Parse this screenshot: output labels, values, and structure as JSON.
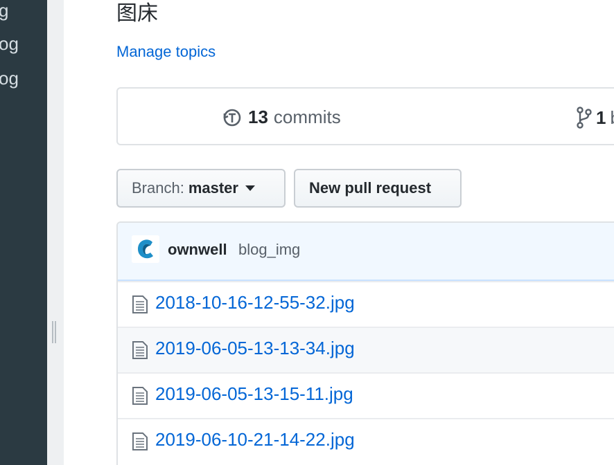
{
  "sidebar": {
    "items": [
      {
        "label": "g"
      },
      {
        "label": "og"
      },
      {
        "label": "og"
      }
    ]
  },
  "repo": {
    "description": "图床",
    "manage_topics": "Manage topics"
  },
  "summary": {
    "commits_count": "13",
    "commits_label": "commits",
    "branches_count": "1",
    "branches_label": "b"
  },
  "toolbar": {
    "branch_prefix": "Branch:",
    "branch_name": "master",
    "new_pull_request": "New pull request"
  },
  "latest_commit": {
    "author": "ownwell",
    "message": "blog_img"
  },
  "files": [
    {
      "name": "2018-10-16-12-55-32.jpg"
    },
    {
      "name": "2019-06-05-13-13-34.jpg"
    },
    {
      "name": "2019-06-05-13-15-11.jpg"
    },
    {
      "name": "2019-06-10-21-14-22.jpg"
    }
  ],
  "colors": {
    "link": "#0366d6",
    "sidebar_bg": "#2b3a42",
    "commit_header_bg": "#f1f8ff"
  },
  "icons": [
    "history-icon",
    "git-branch-icon",
    "caret-down-icon",
    "file-icon",
    "avatar"
  ]
}
